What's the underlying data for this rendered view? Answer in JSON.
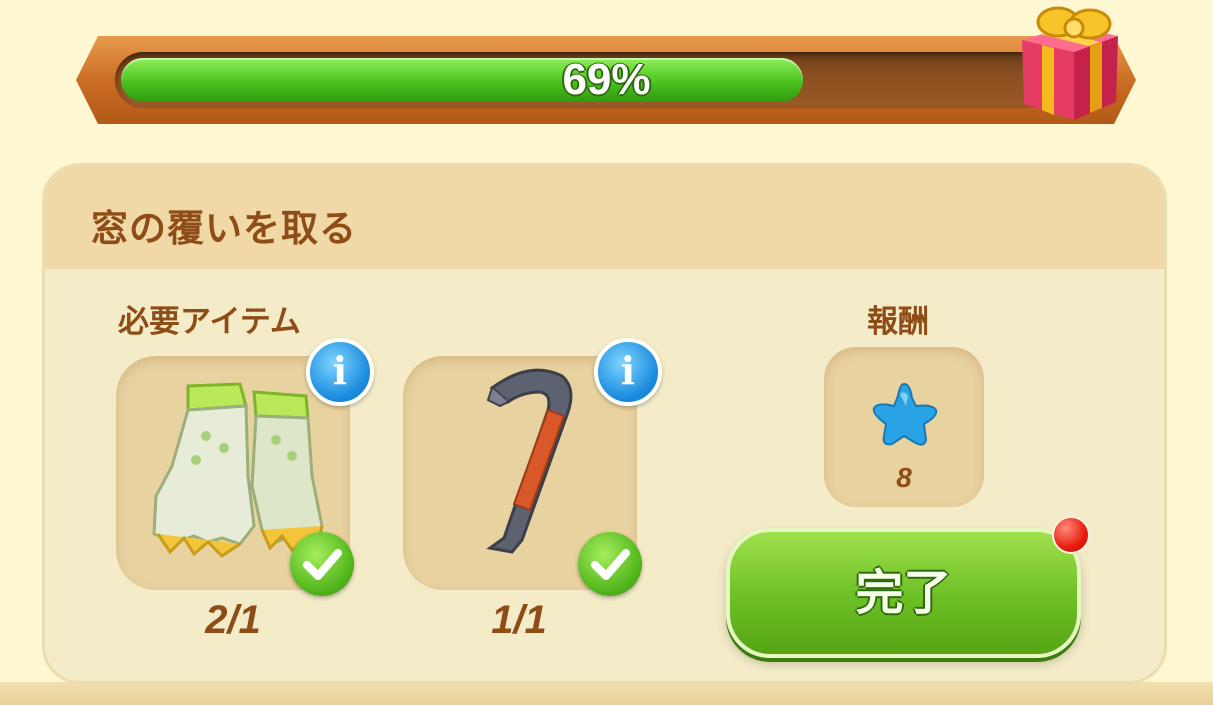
{
  "progress": {
    "value_percent": 69,
    "label": "69%"
  },
  "task": {
    "title": "窓の覆いを取る",
    "required_label": "必要アイテム",
    "reward_label": "報酬",
    "items": [
      {
        "name": "gloves",
        "count": "2/1",
        "info": "i",
        "completed": true
      },
      {
        "name": "crowbar",
        "count": "1/1",
        "info": "i",
        "completed": true
      }
    ],
    "reward": {
      "icon": "blue-star",
      "value": "8"
    },
    "complete_button": "完了"
  },
  "colors": {
    "accent_green": "#6cbf24",
    "text_brown": "#8e4c17",
    "info_blue": "#1c8de0",
    "notification_red": "#e81d0e"
  }
}
